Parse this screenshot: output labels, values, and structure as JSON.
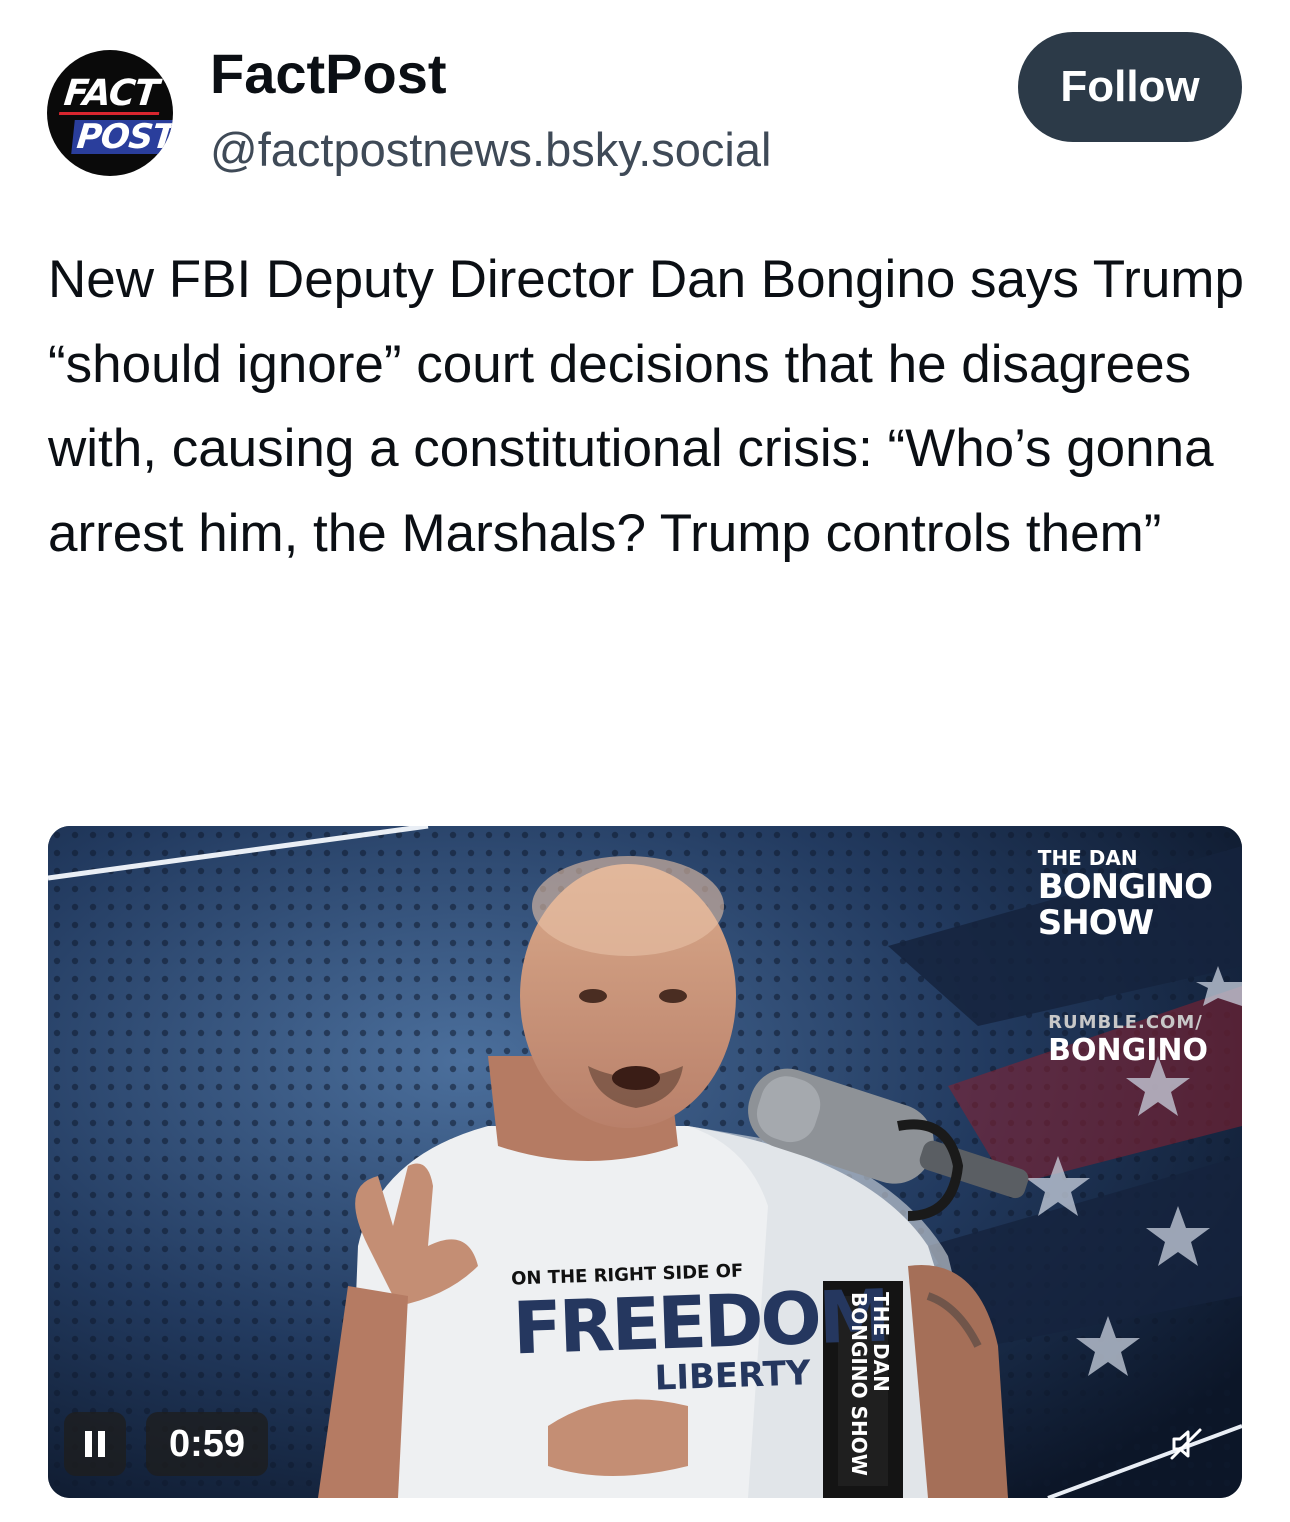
{
  "account": {
    "avatar_icon": "factpost-logo-icon",
    "avatar_text": [
      "FACT",
      "POST"
    ],
    "display_name": "FactPost",
    "handle": "@factpostnews.bsky.social"
  },
  "follow_button": {
    "label": "Follow"
  },
  "post": {
    "text": "New FBI Deputy Director Dan Bongino says Trump “should ignore” court decisions that he disagrees with, causing a constitutional crisis: “Who’s gonna arrest him, the Marshals? Trump controls them”"
  },
  "video": {
    "overlay_brand": {
      "line1": "THE DAN",
      "line2": "BONGINO",
      "line3": "SHOW"
    },
    "overlay_url": {
      "line1": "RUMBLE.COM/",
      "line2": "BONGINO"
    },
    "shirt": {
      "line1": "ON THE RIGHT SIDE OF",
      "line2": "FREEDOM",
      "line3": "LIBERTY"
    },
    "mic_flag": "THE DAN BONGINO SHOW",
    "controls": {
      "pause_icon": "pause-icon",
      "elapsed": "0:59",
      "mute_icon": "muted-speaker-icon"
    }
  }
}
